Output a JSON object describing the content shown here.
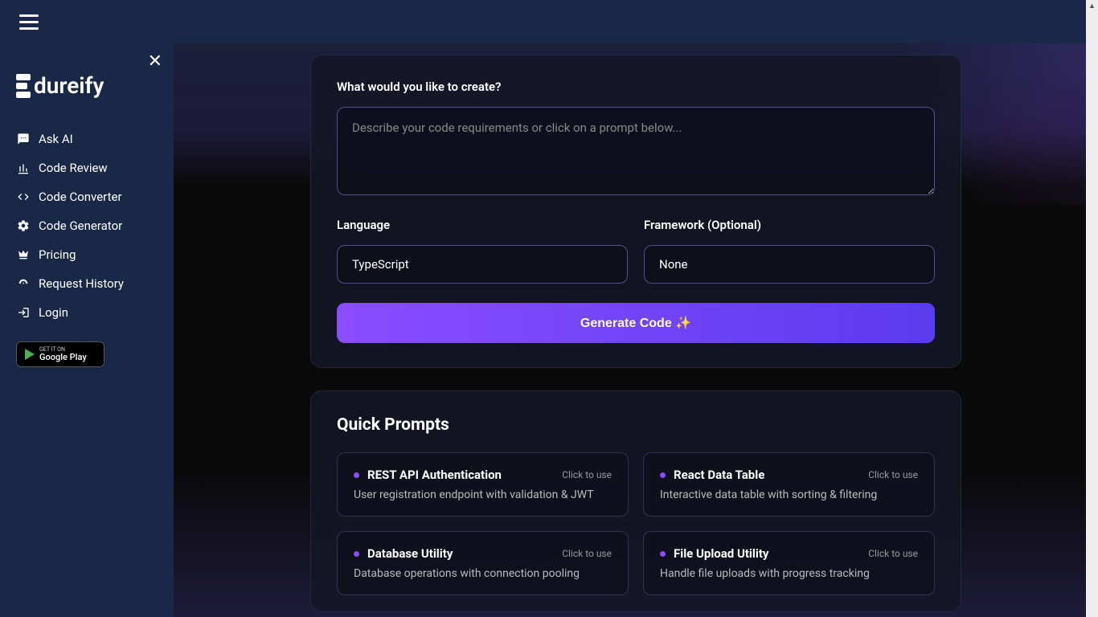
{
  "brand": "dureify",
  "sidebar": {
    "items": [
      {
        "label": "Ask AI"
      },
      {
        "label": "Code Review"
      },
      {
        "label": "Code Converter"
      },
      {
        "label": "Code Generator"
      },
      {
        "label": "Pricing"
      },
      {
        "label": "Request History"
      },
      {
        "label": "Login"
      }
    ],
    "googlePlay": {
      "small": "GET IT ON",
      "large": "Google Play"
    }
  },
  "form": {
    "title": "What would you like to create?",
    "placeholder": "Describe your code requirements or click on a prompt below...",
    "languageLabel": "Language",
    "languageValue": "TypeScript",
    "frameworkLabel": "Framework (Optional)",
    "frameworkValue": "None",
    "button": "Generate Code ✨"
  },
  "prompts": {
    "title": "Quick Prompts",
    "clickHint": "Click to use",
    "cards": [
      {
        "title": "REST API Authentication",
        "desc": "User registration endpoint with validation & JWT"
      },
      {
        "title": "React Data Table",
        "desc": "Interactive data table with sorting & filtering"
      },
      {
        "title": "Database Utility",
        "desc": "Database operations with connection pooling"
      },
      {
        "title": "File Upload Utility",
        "desc": "Handle file uploads with progress tracking"
      }
    ]
  }
}
